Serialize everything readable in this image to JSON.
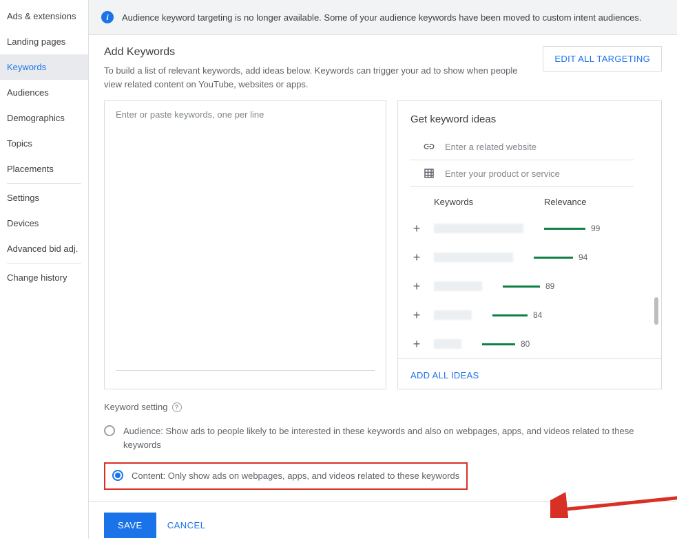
{
  "sidebar": {
    "items": [
      {
        "label": "Ads & extensions"
      },
      {
        "label": "Landing pages"
      },
      {
        "label": "Keywords",
        "active": true
      },
      {
        "label": "Audiences"
      },
      {
        "label": "Demographics"
      },
      {
        "label": "Topics"
      },
      {
        "label": "Placements"
      },
      {
        "label": "Settings"
      },
      {
        "label": "Devices"
      },
      {
        "label": "Advanced bid adj."
      },
      {
        "label": "Change history"
      }
    ]
  },
  "banner": {
    "text": "Audience keyword targeting is no longer available. Some of your audience keywords have been moved to custom intent audiences."
  },
  "header": {
    "title": "Add Keywords",
    "desc": "To build a list of relevant keywords, add ideas below. Keywords can trigger your ad to show when people view related content on YouTube, websites or apps.",
    "edit_button": "EDIT ALL TARGETING"
  },
  "keyword_input": {
    "placeholder": "Enter or paste keywords, one per line"
  },
  "ideas": {
    "title": "Get keyword ideas",
    "website_placeholder": "Enter a related website",
    "product_placeholder": "Enter your product or service",
    "col_keywords": "Keywords",
    "col_relevance": "Relevance",
    "rows": [
      {
        "relevance": 99
      },
      {
        "relevance": 94
      },
      {
        "relevance": 89
      },
      {
        "relevance": 84
      },
      {
        "relevance": 80
      }
    ],
    "add_all": "ADD ALL IDEAS"
  },
  "setting": {
    "label": "Keyword setting",
    "option_audience": "Audience: Show ads to people likely to be interested in these keywords and also on webpages, apps, and videos related to these keywords",
    "option_content": "Content: Only show ads on webpages, apps, and videos related to these keywords"
  },
  "footer": {
    "save": "SAVE",
    "cancel": "CANCEL"
  }
}
